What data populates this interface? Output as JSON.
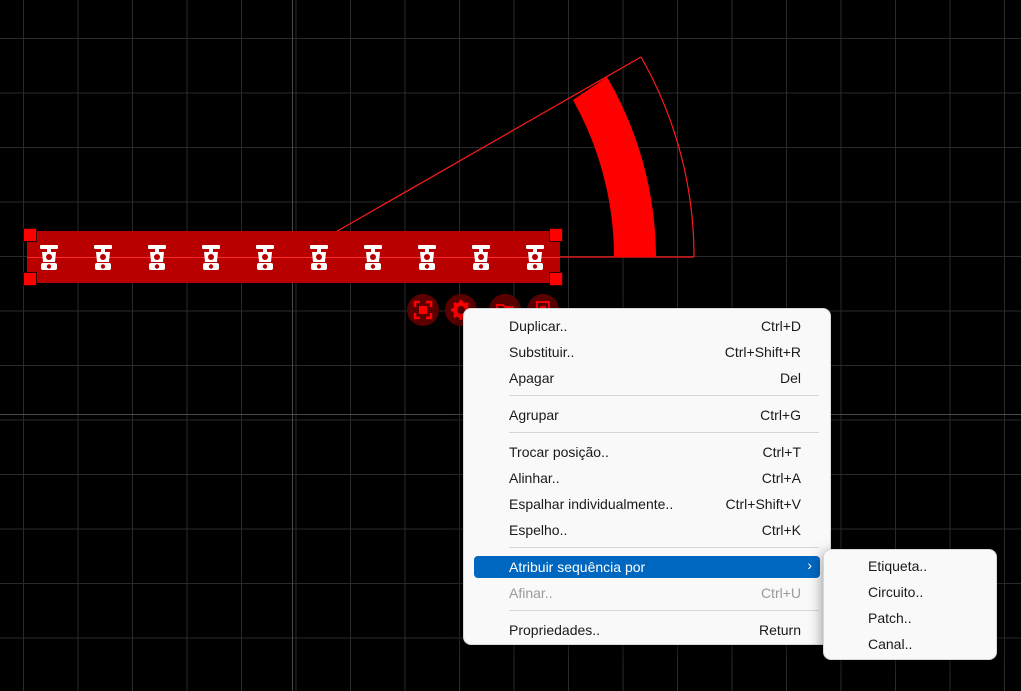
{
  "colors": {
    "background": "#000000",
    "grid": "#2a2a2a",
    "selection_red": "#ff0000",
    "fixture_bar": "#b80000",
    "menu_bg": "#f9f9f9",
    "menu_highlight": "#0067c0",
    "disabled_text": "#9a9a9a"
  },
  "canvas": {
    "fixture_count": 10,
    "fixture_icon": "moving-head-fixture-icon",
    "beam_icon": "beam-arc-icon"
  },
  "toolbar": {
    "items": [
      {
        "icon": "fit-selection-icon"
      },
      {
        "icon": "gear-icon"
      },
      {
        "icon": "folder-icon"
      },
      {
        "icon": "document-icon"
      }
    ]
  },
  "context_menu": {
    "items": [
      {
        "label": "Duplicar..",
        "shortcut": "Ctrl+D"
      },
      {
        "label": "Substituir..",
        "shortcut": "Ctrl+Shift+R"
      },
      {
        "label": "Apagar",
        "shortcut": "Del"
      },
      {
        "label": "Agrupar",
        "shortcut": "Ctrl+G"
      },
      {
        "label": "Trocar posição..",
        "shortcut": "Ctrl+T"
      },
      {
        "label": "Alinhar..",
        "shortcut": "Ctrl+A"
      },
      {
        "label": "Espalhar individualmente..",
        "shortcut": "Ctrl+Shift+V"
      },
      {
        "label": "Espelho..",
        "shortcut": "Ctrl+K"
      },
      {
        "label": "Atribuir sequência por",
        "submenu_arrow": "›"
      },
      {
        "label": "Afinar..",
        "shortcut": "Ctrl+U",
        "disabled": true
      },
      {
        "label": "Propriedades..",
        "shortcut": "Return"
      }
    ]
  },
  "submenu": {
    "items": [
      {
        "label": "Etiqueta.."
      },
      {
        "label": "Circuito.."
      },
      {
        "label": "Patch.."
      },
      {
        "label": "Canal.."
      }
    ]
  }
}
